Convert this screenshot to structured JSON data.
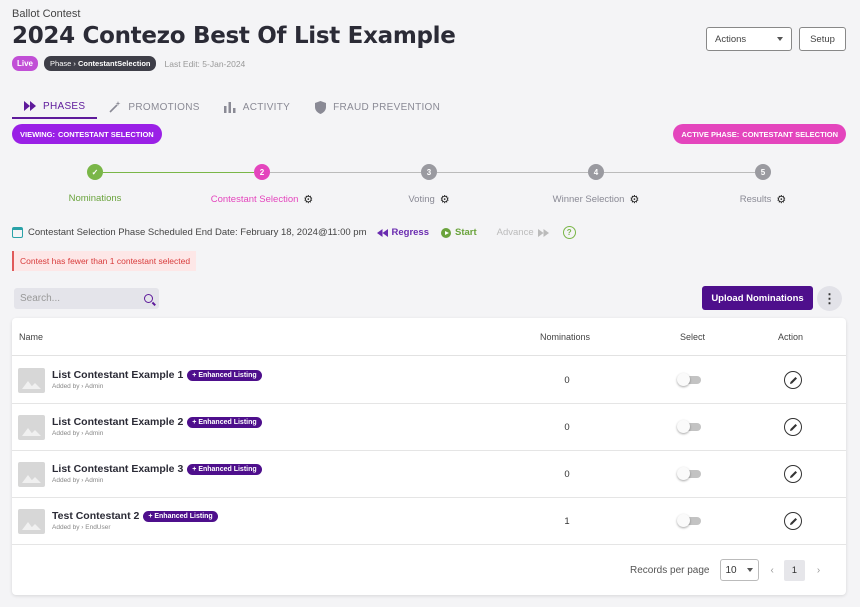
{
  "header": {
    "breadcrumb": "Ballot Contest",
    "title": "2024 Contezo Best Of List Example",
    "status_badge": "Live",
    "phase_badge_prefix": "Phase",
    "phase_badge_value": "ContestantSelection",
    "last_edit": "Last Edit: 5-Jan-2024",
    "actions_label": "Actions",
    "setup_label": "Setup"
  },
  "tabs": [
    {
      "label": "PHASES",
      "icon": "fast-forward-icon",
      "active": true
    },
    {
      "label": "PROMOTIONS",
      "icon": "magic-wand-icon",
      "active": false
    },
    {
      "label": "ACTIVITY",
      "icon": "bar-chart-icon",
      "active": false
    },
    {
      "label": "FRAUD PREVENTION",
      "icon": "shield-icon",
      "active": false
    }
  ],
  "viewing": {
    "prefix": "VIEWING:",
    "value": "CONTESTANT SELECTION"
  },
  "active_phase": {
    "prefix": "ACTIVE PHASE:",
    "value": "CONTESTANT SELECTION"
  },
  "steps": [
    {
      "number": "✓",
      "label": "Nominations",
      "state": "done",
      "has_settings": false
    },
    {
      "number": "2",
      "label": "Contestant Selection",
      "state": "current",
      "has_settings": true
    },
    {
      "number": "3",
      "label": "Voting",
      "state": "upcoming",
      "has_settings": true
    },
    {
      "number": "4",
      "label": "Winner Selection",
      "state": "upcoming",
      "has_settings": true
    },
    {
      "number": "5",
      "label": "Results",
      "state": "upcoming",
      "has_settings": true
    }
  ],
  "phase_controls": {
    "end_date_text": "Contestant Selection Phase Scheduled End Date: February 18, 2024@11:00 pm",
    "regress_label": "Regress",
    "start_label": "Start",
    "advance_label": "Advance",
    "help_label": "?"
  },
  "alert": "Contest has fewer than 1 contestant selected",
  "search": {
    "placeholder": "Search..."
  },
  "upload_label": "Upload Nominations",
  "kebab_label": "⋮",
  "table": {
    "columns": {
      "name": "Name",
      "nominations": "Nominations",
      "select": "Select",
      "action": "Action"
    },
    "rows": [
      {
        "name": "List Contestant Example 1",
        "badge": "+ Enhanced Listing",
        "added_by": "Added by › Admin",
        "nominations": "0",
        "selected": false
      },
      {
        "name": "List Contestant Example 2",
        "badge": "+ Enhanced Listing",
        "added_by": "Added by › Admin",
        "nominations": "0",
        "selected": false
      },
      {
        "name": "List Contestant Example 3",
        "badge": "+ Enhanced Listing",
        "added_by": "Added by › Admin",
        "nominations": "0",
        "selected": false
      },
      {
        "name": "Test Contestant 2",
        "badge": "+ Enhanced Listing",
        "added_by": "Added by › EndUser",
        "nominations": "1",
        "selected": false
      }
    ]
  },
  "pagination": {
    "records_label": "Records per page",
    "per_page": "10",
    "current_page": "1",
    "prev": "‹",
    "next": "›"
  },
  "colors": {
    "brand_purple": "#4e0f8c",
    "viewing_pill": "#9a20e6",
    "active_pill": "#e445bd",
    "done_green": "#7ab648",
    "current_pink": "#e445bd",
    "upcoming_gray": "#9a9aa0"
  }
}
